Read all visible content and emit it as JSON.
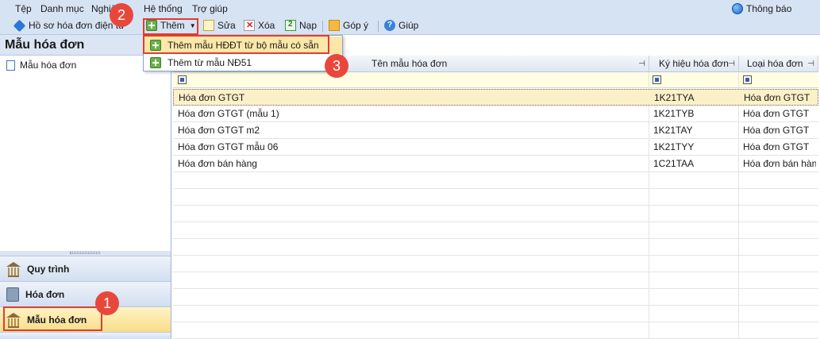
{
  "menu": [
    "Tệp",
    "Danh mục",
    "Nghiệ",
    "Hệ thống",
    "Trợ giúp"
  ],
  "notify_label": "Thông báo",
  "toolbar": {
    "profile_label": "Hồ sơ hóa đơn điện tử",
    "add_label": "Thêm",
    "edit_label": "Sửa",
    "delete_label": "Xóa",
    "load_label": "Nạp",
    "feedback_label": "Góp ý",
    "help_label": "Giúp"
  },
  "dropdown": {
    "items": [
      "Thêm mẫu HĐĐT từ bộ mẫu có sẵn",
      "Thêm từ mẫu NĐ51"
    ]
  },
  "left_panel": {
    "title": "Mẫu hóa đơn",
    "tree_item": "Mẫu hóa đơn",
    "nav": [
      "Quy trình",
      "Hóa đơn",
      "Mẫu hóa đơn"
    ]
  },
  "grid": {
    "columns": [
      "Tên mẫu hóa đơn",
      "Ký hiệu hóa đơn",
      "Loại hóa đơn"
    ],
    "rows": [
      [
        "Hóa đơn GTGT",
        "1K21TYA",
        "Hóa đơn GTGT"
      ],
      [
        "Hóa đơn GTGT (mẫu 1)",
        "1K21TYB",
        "Hóa đơn GTGT"
      ],
      [
        "Hóa đơn GTGT m2",
        "1K21TAY",
        "Hóa đơn GTGT"
      ],
      [
        "Hóa đơn GTGT mẫu 06",
        "1K21TYY",
        "Hóa đơn GTGT"
      ],
      [
        "Hóa đơn bán hàng",
        "1C21TAA",
        "Hóa đơn bán hàn"
      ]
    ]
  },
  "badges": [
    "1",
    "2",
    "3"
  ],
  "colors": {
    "highlight": "#e03c32",
    "badge": "#e8483c",
    "selection": "#fbf0c8"
  }
}
